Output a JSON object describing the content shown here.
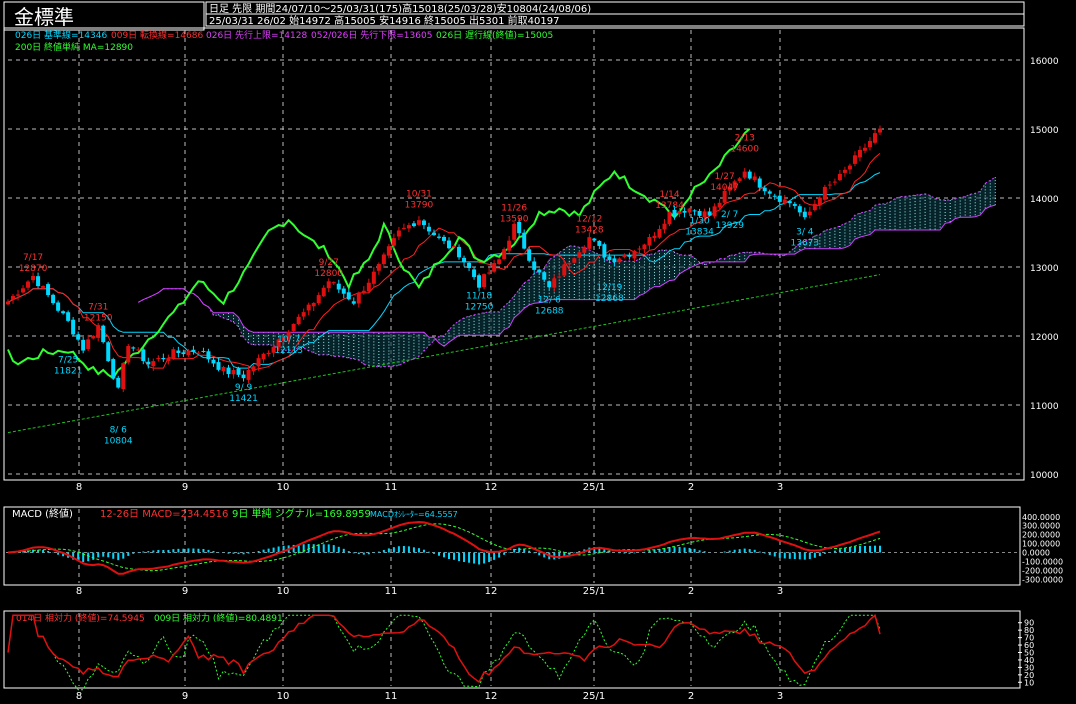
{
  "header": {
    "title": "金標準",
    "line1": "日足 先限 期間24/07/10〜25/03/31(175)高15018(25/03/28)安10804(24/08/06)",
    "line2": "25/03/31 26/02 始14972 高15005 安14916 終15005 出5301 前取40197"
  },
  "legend": {
    "kijun": "026日 基準線=14346",
    "tenkan": "009日 転換線=14686",
    "senkou_a": "026日 先行上限=14128",
    "senkou_b": "052/026日 先行下限=13605",
    "chikou": "026日 遅行線(終値)=15005",
    "ma": "200日 終値単純 MA=12890"
  },
  "macd_legend": {
    "label": "MACD (終値)",
    "macd": "12-26日 MACD=234.4516",
    "signal": "9日 単純 シグナル=169.8959",
    "osc": "MACDｵｼﾚｰﾀｰ=64.5557"
  },
  "rsi_legend": {
    "rsi1": "014日 相対力 (終値)=74.5945",
    "rsi2": "009日 相対力 (終値)=80.4891"
  },
  "colors": {
    "up": "#e01010",
    "down": "#00d8ff",
    "tenkan": "#ff2020",
    "kijun": "#00d8ff",
    "senkou": "#d040ff",
    "chikou": "#30ff30",
    "ma": "#20c020",
    "text_red": "#ff3030",
    "text_cyan": "#00d8ff",
    "text_green": "#30ff30",
    "text_magenta": "#e040ff"
  },
  "chart_data": [
    {
      "type": "candlestick",
      "ylim": [
        10000,
        16000
      ],
      "y_ticks": [
        "16000",
        "15000",
        "14000",
        "13000",
        "12000",
        "11000",
        "10000"
      ],
      "x_ticks": [
        "8",
        "9",
        "10",
        "11",
        "12",
        "25/1",
        "2",
        "3"
      ],
      "anchors": [
        [
          0,
          12500
        ],
        [
          5,
          12870
        ],
        [
          12,
          12200
        ],
        [
          15,
          11821
        ],
        [
          18,
          12150
        ],
        [
          22,
          11200
        ],
        [
          24,
          11900
        ],
        [
          28,
          11600
        ],
        [
          33,
          11750
        ],
        [
          38,
          11800
        ],
        [
          43,
          11500
        ],
        [
          47,
          11421
        ],
        [
          52,
          11800
        ],
        [
          56,
          12113
        ],
        [
          60,
          12400
        ],
        [
          64,
          12800
        ],
        [
          69,
          12500
        ],
        [
          74,
          13000
        ],
        [
          78,
          13500
        ],
        [
          82,
          13700
        ],
        [
          86,
          13400
        ],
        [
          90,
          13200
        ],
        [
          94,
          12750
        ],
        [
          98,
          13100
        ],
        [
          101,
          13590
        ],
        [
          105,
          13000
        ],
        [
          108,
          12688
        ],
        [
          112,
          13100
        ],
        [
          116,
          13428
        ],
        [
          120,
          13100
        ],
        [
          124,
          13200
        ],
        [
          128,
          13400
        ],
        [
          132,
          13784
        ],
        [
          136,
          13850
        ],
        [
          140,
          13750
        ],
        [
          143,
          14050
        ],
        [
          147,
          14400
        ],
        [
          150,
          14200
        ],
        [
          154,
          14000
        ],
        [
          157,
          13900
        ],
        [
          159,
          13673
        ],
        [
          162,
          14050
        ],
        [
          166,
          14300
        ],
        [
          170,
          14650
        ],
        [
          174,
          15005
        ]
      ],
      "annotations": [
        {
          "text": "7/17",
          "value": 12870,
          "bar": 5,
          "kind": "high"
        },
        {
          "text": "7/25",
          "value": 11821,
          "bar": 12,
          "kind": "low"
        },
        {
          "text": "7/31",
          "value": 12150,
          "bar": 18,
          "kind": "high"
        },
        {
          "text": "8/ 6",
          "value": 10804,
          "bar": 22,
          "kind": "low"
        },
        {
          "text": "9/ 9",
          "value": 11421,
          "bar": 47,
          "kind": "low"
        },
        {
          "text": "10/ 7",
          "value": 12113,
          "bar": 56,
          "kind": "low"
        },
        {
          "text": "9/27",
          "value": 12800,
          "bar": 64,
          "kind": "high"
        },
        {
          "text": "10/31",
          "value": 13790,
          "bar": 82,
          "kind": "high"
        },
        {
          "text": "11/18",
          "value": 12750,
          "bar": 94,
          "kind": "low"
        },
        {
          "text": "11/26",
          "value": 13590,
          "bar": 101,
          "kind": "high"
        },
        {
          "text": "12/ 6",
          "value": 12688,
          "bar": 108,
          "kind": "low"
        },
        {
          "text": "12/12",
          "value": 13428,
          "bar": 116,
          "kind": "high"
        },
        {
          "text": "12/19",
          "value": 12868,
          "bar": 120,
          "kind": "low"
        },
        {
          "text": "1/14",
          "value": 13784,
          "bar": 132,
          "kind": "high"
        },
        {
          "text": "1/27",
          "value": 14047,
          "bar": 143,
          "kind": "high"
        },
        {
          "text": "1/30",
          "value": 13834,
          "bar": 138,
          "kind": "low"
        },
        {
          "text": "2/13",
          "value": 14600,
          "bar": 147,
          "kind": "high"
        },
        {
          "text": "2/ 7",
          "value": 13929,
          "bar": 144,
          "kind": "low"
        },
        {
          "text": "3/ 4",
          "value": 13673,
          "bar": 159,
          "kind": "low"
        }
      ],
      "moving_average_200": {
        "start": 10600,
        "end": 12890
      },
      "ichimoku": {
        "tenkan": 14686,
        "kijun": 14346,
        "senkou_a": 14128,
        "senkou_b": 13605,
        "chikou": 15005
      }
    },
    {
      "type": "macd",
      "y_ticks": [
        "400.0000",
        "300.0000",
        "200.0000",
        "100.0000",
        "0.0000",
        "-100.0000",
        "-200.0000",
        "-300.0000"
      ],
      "x_ticks": [
        "8",
        "9",
        "10",
        "11",
        "12",
        "25/1",
        "2",
        "3"
      ],
      "ylim": [
        -330,
        420
      ],
      "macd": 234.4516,
      "signal": 169.8959,
      "oscillator": 64.5557
    },
    {
      "type": "rsi",
      "y_ticks": [
        "90",
        "80",
        "70",
        "60",
        "50",
        "40",
        "30",
        "20",
        "10"
      ],
      "x_ticks": [
        "8",
        "9",
        "10",
        "11",
        "12",
        "25/1",
        "2",
        "3"
      ],
      "ylim": [
        5,
        95
      ],
      "rsi14": 74.5945,
      "rsi9": 80.4891
    }
  ]
}
